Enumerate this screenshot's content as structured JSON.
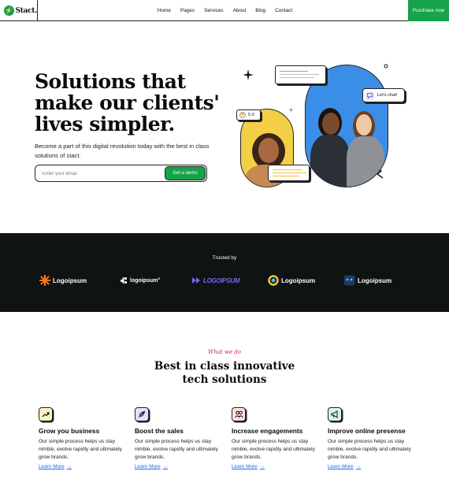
{
  "nav": {
    "brand": "Stact.",
    "links": [
      "Home",
      "Pages",
      "Services",
      "About",
      "Blog",
      "Contact"
    ],
    "cta": "Purchase now"
  },
  "hero": {
    "title_lines": [
      "Solutions that",
      "make our clients'",
      "lives simpler."
    ],
    "subtitle": "Become a part of this digital revolution today with the best in class solutions of stact.",
    "email_placeholder": "Enter your email",
    "demo_button": "Get a demo",
    "rating": "5.0",
    "chat": "Let's chat!"
  },
  "trusted": {
    "label": "Trusted by",
    "logos": [
      "Logoipsum",
      "logoipsum°",
      "LOGOIPSUM",
      "Logoipsum",
      "Logoipsum"
    ]
  },
  "services": {
    "eyebrow": "What we do",
    "title": "Best in class innovative tech solutions",
    "items": [
      {
        "title": "Grow you business",
        "text": "Our simple process helps us stay nimble, evolve rapidly and ultimately grow brands.",
        "link": "Learn More",
        "icon": "trend-up-icon",
        "color": "#fbf3c4"
      },
      {
        "title": "Boost the sales",
        "text": "Our simple process helps us stay nimble, evolve rapidly and ultimately grow brands.",
        "link": "Learn More",
        "icon": "rocket-icon",
        "color": "#e3e0fb"
      },
      {
        "title": "Increase engagements",
        "text": "Our simple process helps us stay nimble, evolve rapidly and ultimately grow brands.",
        "link": "Learn More",
        "icon": "users-icon",
        "color": "#fde4de"
      },
      {
        "title": "Improve online presense",
        "text": "Our simple process helps us stay nimble, evolve rapidly and ultimately grow brands.",
        "link": "Learn More",
        "icon": "megaphone-icon",
        "color": "#dcf5e3"
      }
    ]
  },
  "colors": {
    "accent": "#16a34a",
    "dark": "#0f1311",
    "link": "#2563eb",
    "eyebrow": "#e11d48",
    "yellow": "#f3cf46",
    "blue": "#3b8ee8"
  }
}
